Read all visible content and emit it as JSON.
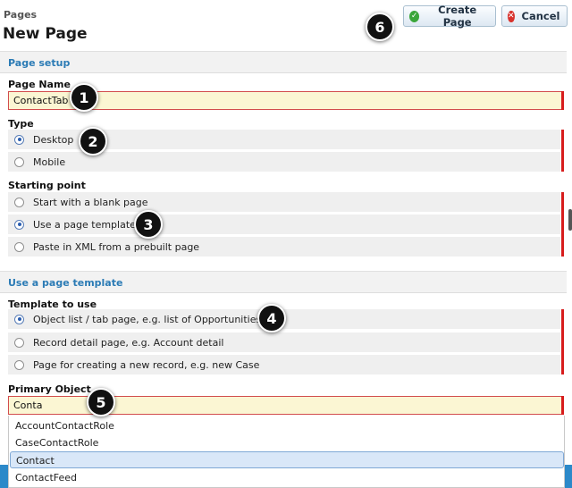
{
  "header": {
    "breadcrumb": "Pages",
    "title": "New Page",
    "create_label": "Create Page",
    "cancel_label": "Cancel"
  },
  "page_setup": {
    "section_title": "Page setup",
    "page_name_label": "Page Name",
    "page_name_value": "ContactTab",
    "type_label": "Type",
    "type_options": [
      "Desktop",
      "Mobile"
    ],
    "type_selected": "Desktop",
    "starting_point_label": "Starting point",
    "starting_options": [
      "Start with a blank page",
      "Use a page template",
      "Paste in XML from a prebuilt page"
    ],
    "starting_selected": "Use a page template"
  },
  "template_section": {
    "section_title": "Use a page template",
    "template_label": "Template to use",
    "template_options": [
      "Object list / tab page, e.g. list of Opportunities",
      "Record detail page, e.g. Account detail",
      "Page for creating a new record, e.g. new Case"
    ],
    "template_selected": "Object list / tab page, e.g. list of Opportunities",
    "primary_object_label": "Primary Object",
    "primary_object_value": "Conta",
    "suggestions": [
      "AccountContactRole",
      "CaseContactRole",
      "Contact",
      "ContactFeed"
    ],
    "suggestion_highlighted": "Contact"
  },
  "callouts": [
    "1",
    "2",
    "3",
    "4",
    "5",
    "6"
  ],
  "icons": {
    "create": "check-circle-icon",
    "cancel": "x-circle-icon"
  },
  "colors": {
    "accent": "#2b7bb5",
    "required": "#d71c1c",
    "input_bg": "#fbf6d3",
    "selected_item": "#d9e7f8"
  }
}
